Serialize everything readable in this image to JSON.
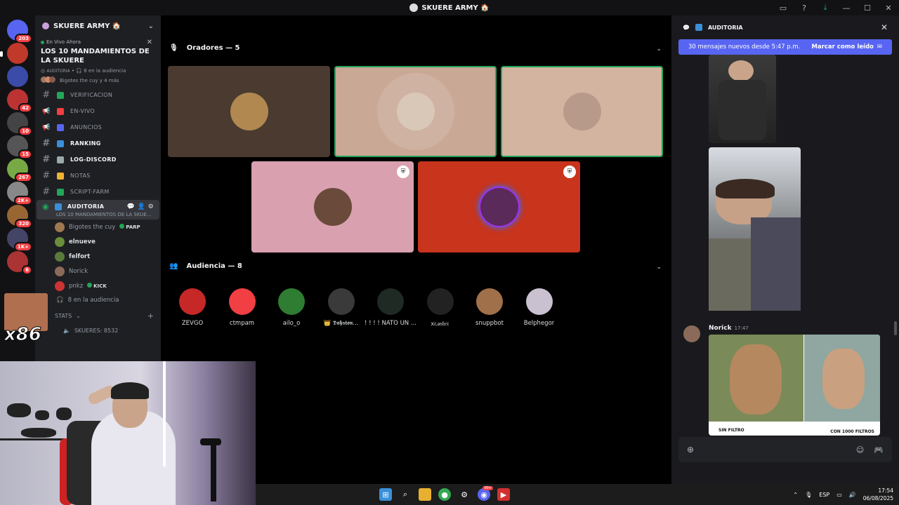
{
  "window": {
    "title": "SKUERE ARMY 🏠",
    "controls": [
      "monitor-icon",
      "help-icon",
      "download-icon",
      "minimize",
      "maximize",
      "close"
    ]
  },
  "server_rail": [
    {
      "badge": "203",
      "color": "#5865f2"
    },
    {
      "badge": "",
      "color": "#c0392b"
    },
    {
      "badge": "",
      "color": "#3b4ba8"
    },
    {
      "badge": "42",
      "color": "#b33"
    },
    {
      "badge": "10",
      "color": "#444"
    },
    {
      "badge": "15",
      "color": "#555"
    },
    {
      "badge": "267",
      "color": "#7a4"
    },
    {
      "badge": "2K+",
      "color": "#888"
    },
    {
      "badge": "320",
      "color": "#963"
    },
    {
      "badge": "1K+",
      "color": "#446"
    },
    {
      "badge": "6",
      "color": "#a33"
    }
  ],
  "sidebar": {
    "server_name": "SKUERE ARMY 🏠",
    "live_event": {
      "tag": "En Vivo Ahora",
      "title": "LOS 10 MANDAMIENTOS DE LA SKUERE",
      "channel": "AUDITORIA",
      "audience": "8 en la audiencia",
      "speakers": "Bigotes the cuy y 4 más"
    },
    "channels": [
      {
        "name": "VERIFICACION",
        "icon": "#",
        "emoji_color": "#23a55a",
        "bold": false
      },
      {
        "name": "EN-VIVO",
        "icon": "speaker",
        "emoji_color": "#f23f43",
        "bold": false
      },
      {
        "name": "ANUNCIOS",
        "icon": "speaker",
        "emoji_color": "#5865f2",
        "bold": false
      },
      {
        "name": "RANKING",
        "icon": "#",
        "emoji_color": "#3a8fd9",
        "bold": true
      },
      {
        "name": "LOG-DISCORD",
        "icon": "#",
        "emoji_color": "#9aa",
        "bold": true
      },
      {
        "name": "NOTAS",
        "icon": "#",
        "emoji_color": "#f0b232",
        "bold": false
      },
      {
        "name": "SCRIPT-FARM",
        "icon": "#",
        "emoji_color": "#23a55a",
        "bold": false
      }
    ],
    "active_channel": {
      "name": "AUDITORIA",
      "subtitle": "LOS 10 MANDAMIENTOS DE LA SKUE..."
    },
    "stage_members": [
      {
        "name": "Bigotes the cuy",
        "tag": "PARP",
        "bright": false,
        "color": "#a07850"
      },
      {
        "name": "elnueve",
        "tag": "",
        "bright": true,
        "color": "#6b8e3a"
      },
      {
        "name": "felfort",
        "tag": "",
        "bright": true,
        "color": "#5a7a3a"
      },
      {
        "name": "Norick",
        "tag": "",
        "bright": false,
        "color": "#8b6a5a"
      },
      {
        "name": "pnkz",
        "tag": "KICK",
        "bright": false,
        "color": "#c33"
      }
    ],
    "audience_link": "8 en la audiencia",
    "stats_category": "STATS",
    "skueres_stat": "SKUERES: 8532"
  },
  "stage": {
    "speakers_header": "Oradores — 5",
    "audience_header": "Audiencia — 8",
    "speakers": [
      {
        "bg": "#4a3a30",
        "av": "#b08850",
        "speaking": false,
        "mod": false
      },
      {
        "bg": "#c9a896",
        "av": "#d9c8b8",
        "speaking": true,
        "mod": false
      },
      {
        "bg": "#d2b4a0",
        "av": "#b89a8a",
        "speaking": true,
        "mod": false
      },
      {
        "bg": "#d9a0b0",
        "av": "#6a4a3a",
        "speaking": false,
        "mod": true
      },
      {
        "bg": "#c8341c",
        "av": "#5a2a5a",
        "speaking": false,
        "mod": true
      }
    ],
    "audience": [
      {
        "name": "ZEVGO",
        "color": "#c62828"
      },
      {
        "name": "ctmpam",
        "color": "#f23f43"
      },
      {
        "name": "ailo_o",
        "color": "#2e7d32"
      },
      {
        "name": "👑 𝕯𝖔𝖍𝖘𝖙𝖔𝖓...",
        "color": "#3a3a3a"
      },
      {
        "name": "! ! ! ! ÑATO UN ...",
        "color": "#1f2a24"
      },
      {
        "name": "ꭗ𝔯ꭿ𝔰𝔥𝔢𝔯",
        "color": "#222"
      },
      {
        "name": "snuppbot",
        "color": "#a0704a"
      },
      {
        "name": "Belphegor",
        "color": "#c9c0d0"
      }
    ]
  },
  "chat": {
    "channel": "AUDITORIA",
    "new_messages": "30 mensajes nuevos desde 5:47 p.m.",
    "mark_read": "Marcar como leído",
    "author": "Norick",
    "time": "17:47",
    "meme_left": "SIN FILTRO",
    "meme_right": "CON 1000 FILTROS"
  },
  "taskbar": {
    "lang": "ESP",
    "time": "17:54",
    "date": "06/08/2025"
  }
}
